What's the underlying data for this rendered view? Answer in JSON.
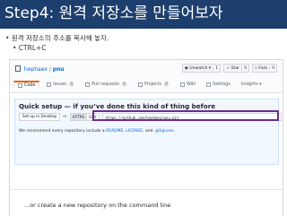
{
  "slide": {
    "title": "Step4: 원격 저장소를 만들어보자",
    "bullet_main": "• 원격 저장소의 주소를 복사해 놓자.",
    "bullet_sub": "• CTRL+C"
  },
  "github": {
    "owner": "hephaex",
    "separator": "/",
    "repo": "pnu",
    "buttons": {
      "unwatch": "◉ Unwatch ▾",
      "unwatch_count": "1",
      "star": "☆ Star",
      "star_count": "0",
      "fork": "⑂ Fork",
      "fork_count": "0"
    },
    "tabs": [
      {
        "label": "Code"
      },
      {
        "label": "Issues",
        "count": "0"
      },
      {
        "label": "Pull requests",
        "count": "0"
      },
      {
        "label": "Projects",
        "count": "0"
      },
      {
        "label": "Wiki"
      },
      {
        "label": "Settings"
      },
      {
        "label": "Insights ▾"
      }
    ],
    "quick_setup": {
      "title": "Quick setup — if you’ve done this kind of thing before",
      "desktop_button": "Set up in Desktop",
      "or": "or",
      "https_label": "HTTPS",
      "ssh_label": "SSH",
      "clone_url": "https://github.com/hephaex/pnu.git",
      "recommend_prefix": "We recommend every repository include a ",
      "readme": "README",
      "comma": ", ",
      "license": "LICENSE",
      "and": ", and ",
      "gitignore": ".gitignore",
      "period": "."
    },
    "command_line_title": "...or create a new repository on the command line"
  }
}
